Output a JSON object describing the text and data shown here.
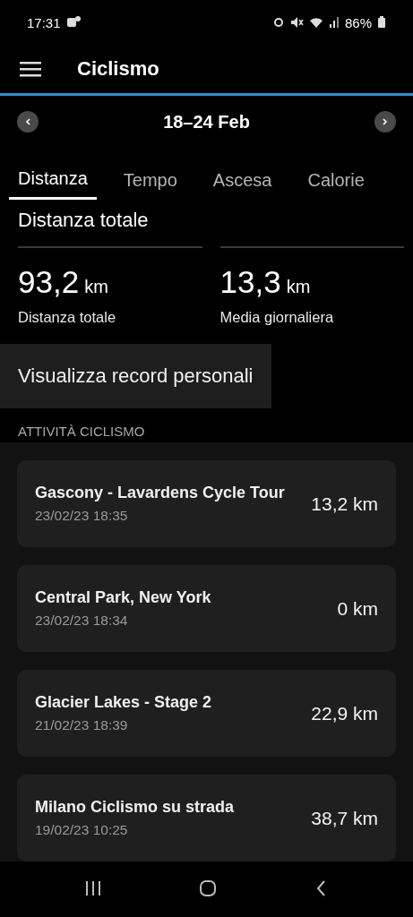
{
  "status_bar": {
    "time": "17:31",
    "battery": "86%"
  },
  "title": "Ciclismo",
  "week": {
    "label": "18–24 Feb"
  },
  "tabs": [
    {
      "label": "Distanza",
      "selected": true
    },
    {
      "label": "Tempo",
      "selected": false
    },
    {
      "label": "Ascesa",
      "selected": false
    },
    {
      "label": "Calorie",
      "selected": false
    }
  ],
  "section_title": "Distanza totale",
  "stats": [
    {
      "value": "93,2",
      "unit": "km",
      "label": "Distanza totale"
    },
    {
      "value": "13,3",
      "unit": "km",
      "label": "Media giornaliera"
    }
  ],
  "records_link": "Visualizza record personali",
  "list_header": "ATTIVITÀ CICLISMO",
  "activities": [
    {
      "name": "Gascony - Lavardens Cycle Tour",
      "date": "23/02/23 18:35",
      "distance": "13,2 km"
    },
    {
      "name": "Central Park, New York",
      "date": "23/02/23 18:34",
      "distance": "0 km"
    },
    {
      "name": "Glacier Lakes - Stage 2",
      "date": "21/02/23 18:39",
      "distance": "22,9 km"
    },
    {
      "name": "Milano Ciclismo su strada",
      "date": "19/02/23 10:25",
      "distance": "38,7 km"
    }
  ]
}
